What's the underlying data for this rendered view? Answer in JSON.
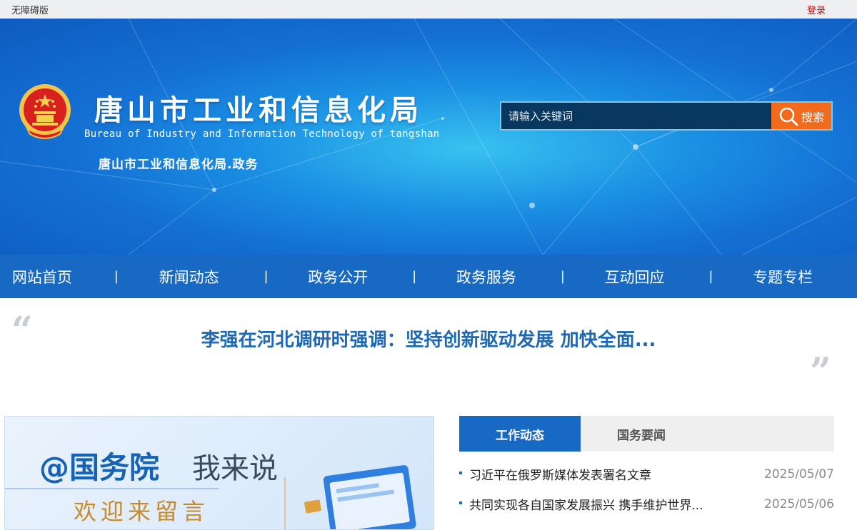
{
  "topbar": {
    "accessibility": "无障碍版",
    "login": "登录"
  },
  "header": {
    "title": "唐山市工业和信息化局",
    "subtitle_en": "Bureau of Industry and Information Technology of tangshan",
    "subtitle": "唐山市工业和信息化局.政务",
    "emblem_icon": "national-emblem-icon"
  },
  "search": {
    "placeholder": "请输入关键词",
    "button": "搜索",
    "icon": "magnifier-icon"
  },
  "nav": [
    "网站首页",
    "新闻动态",
    "政务公开",
    "政务服务",
    "互动回应",
    "专题专栏"
  ],
  "headline": "李强在河北调研时强调：坚持创新驱动发展 加快全面...",
  "promo": {
    "line1": "@国务院",
    "line2": "我来说",
    "line3": "欢迎来留言"
  },
  "tabs": [
    "工作动态",
    "国务要闻"
  ],
  "news": [
    {
      "title": "习近平在俄罗斯媒体发表署名文章",
      "date": "2025/05/07"
    },
    {
      "title": "共同实现各自国家发展振兴 携手维护世界...",
      "date": "2025/05/06"
    }
  ],
  "colors": {
    "nav": "#1769c4",
    "search_button": "#f26a1b",
    "login": "#c40000",
    "headline": "#1e69b6"
  }
}
